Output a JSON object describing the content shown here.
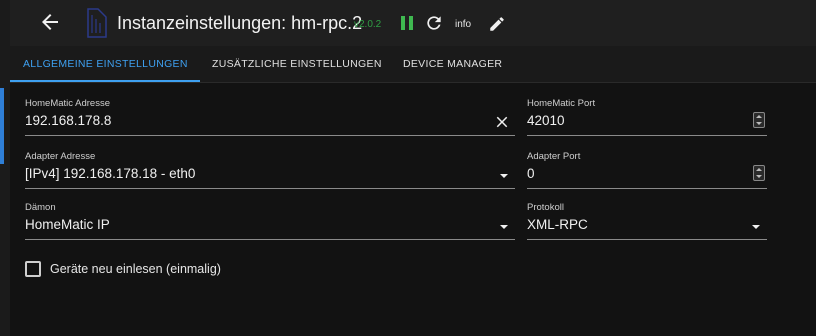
{
  "header": {
    "title": "Instanzeinstellungen: hm-rpc.2",
    "version": "v2.0.2",
    "info_label": "info"
  },
  "tabs": [
    {
      "label": "ALLGEMEINE EINSTELLUNGEN",
      "active": true
    },
    {
      "label": "ZUSÄTZLICHE EINSTELLUNGEN",
      "active": false
    },
    {
      "label": "DEVICE MANAGER",
      "active": false
    }
  ],
  "form": {
    "homematic_address": {
      "label": "HomeMatic Adresse",
      "value": "192.168.178.8"
    },
    "homematic_port": {
      "label": "HomeMatic Port",
      "value": "42010"
    },
    "adapter_address": {
      "label": "Adapter Adresse",
      "value": "[IPv4]  192.168.178.18 - eth0"
    },
    "adapter_port": {
      "label": "Adapter Port",
      "value": "0"
    },
    "daemon": {
      "label": "Dämon",
      "value": "HomeMatic IP"
    },
    "protocol": {
      "label": "Protokoll",
      "value": "XML-RPC"
    },
    "reload_devices": {
      "label": "Geräte neu einlesen (einmalig)",
      "checked": false
    }
  },
  "colors": {
    "accent": "#3ea0f0",
    "version": "#2f9e44",
    "pause_icon": "#3fb950",
    "background": "#121212"
  },
  "icons": [
    "arrow-back-icon",
    "adapter-logo-icon",
    "pause-icon",
    "reload-icon",
    "edit-icon",
    "clear-icon",
    "dropdown-caret-icon",
    "spinner-icon",
    "checkbox-icon"
  ]
}
